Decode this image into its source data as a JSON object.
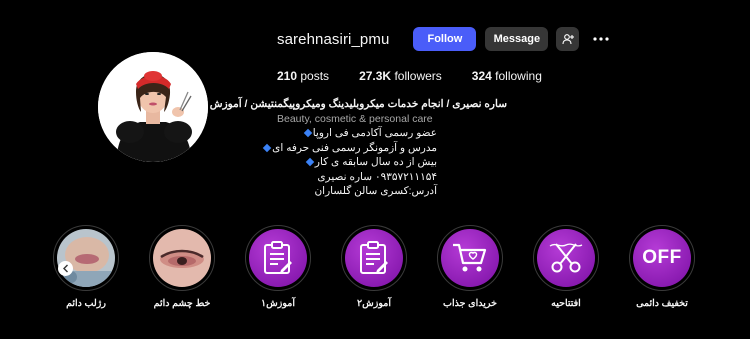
{
  "profile": {
    "username": "sarehnasiri_pmu",
    "follow_label": "Follow",
    "message_label": "Message"
  },
  "stats": {
    "posts_count": "210",
    "posts_label": "posts",
    "followers_count": "27.3K",
    "followers_label": "followers",
    "following_count": "324",
    "following_label": "following"
  },
  "bio": {
    "name_line": "ساره نصیری / انجام خدمات میکروبلیدینگ ومیکروپیگمنتیشن / آموزش",
    "category": "Beauty, cosmetic & personal care",
    "lines": [
      "عضو رسمی آکادمی فی اروپا",
      "مدرس و آزمونگر رسمی فنی حرفه ای",
      "بیش از ده سال سابقه ی کار",
      "۰۹۳۵۷۲۱۱۱۵۴ ساره نصیری",
      "آدرس:کسری سالن گلساران"
    ]
  },
  "highlights": [
    {
      "label": "رژلب دائم",
      "icon": "photo-lips"
    },
    {
      "label": "خط چشم دائم",
      "icon": "photo-eyeliner"
    },
    {
      "label": "آموزش۱",
      "icon": "clipboard-icon"
    },
    {
      "label": "آموزش۲",
      "icon": "clipboard-icon"
    },
    {
      "label": "خریدای جذاب",
      "icon": "cart-icon"
    },
    {
      "label": "افتتاحیه",
      "icon": "scissors-icon"
    },
    {
      "label": "تخفیف دائمی",
      "icon": "off-badge",
      "badge_text": "OFF"
    }
  ],
  "colors": {
    "background": "#000000",
    "follow_button": "#4a5df9",
    "secondary_button": "#363636",
    "highlight_purple": "#9b27c4",
    "bullet_blue": "#3b82f6"
  }
}
